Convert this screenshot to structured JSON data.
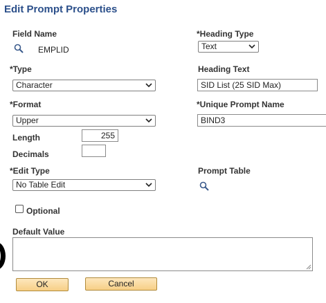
{
  "page": {
    "title": "Edit Prompt Properties"
  },
  "field_name": {
    "label": "Field Name",
    "value": "EMPLID",
    "icon": "search-icon"
  },
  "heading_type": {
    "label": "*Heading Type",
    "selected": "Text"
  },
  "type": {
    "label": "*Type",
    "selected": "Character"
  },
  "heading_text": {
    "label": "Heading Text",
    "value": "SID List (25 SID Max)"
  },
  "format": {
    "label": "*Format",
    "selected": "Upper"
  },
  "unique_prompt_name": {
    "label": "*Unique Prompt Name",
    "value": "BIND3"
  },
  "length": {
    "label": "Length",
    "value": "255"
  },
  "decimals": {
    "label": "Decimals",
    "value": ""
  },
  "edit_type": {
    "label": "*Edit Type",
    "selected": "No Table Edit"
  },
  "prompt_table": {
    "label": "Prompt Table",
    "icon": "search-icon"
  },
  "optional": {
    "label": "Optional",
    "checked": false
  },
  "default_value": {
    "label": "Default Value",
    "value": ""
  },
  "buttons": {
    "ok": "OK",
    "cancel": "Cancel"
  },
  "colors": {
    "title": "#2b4f8a",
    "button_bg": "#f7cf86",
    "button_border": "#b08a3a"
  }
}
